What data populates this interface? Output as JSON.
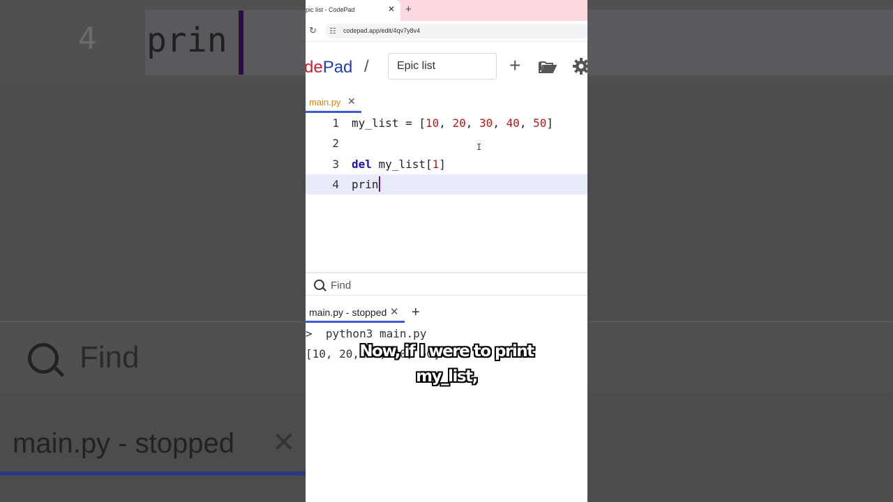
{
  "background": {
    "line_number": "4",
    "code": "prin",
    "find_label": "Find",
    "tab_label": "main.py - stopped",
    "tab_close": "✕"
  },
  "browser": {
    "tab_title": "pic list - CodePad",
    "tab_close": "✕",
    "new_tab": "+",
    "url": "codepad.app/edit/4qv7y8v4"
  },
  "app": {
    "logo_red": "de",
    "logo_blue": "Pad",
    "separator": "/",
    "project_name": "Epic list",
    "add_label": "+"
  },
  "editor": {
    "file_tab": "main.py",
    "file_tab_close": "✕",
    "lines": [
      {
        "num": "1"
      },
      {
        "num": "2"
      },
      {
        "num": "3"
      },
      {
        "num": "4"
      }
    ],
    "line1": {
      "var": "my_list",
      "op": " = ",
      "open": "[",
      "n1": "10",
      "n2": "20",
      "n3": "30",
      "n4": "40",
      "n5": "50",
      "sep": ", ",
      "close": "]"
    },
    "line3": {
      "kw": "del",
      "rest": " my_list[",
      "idx": "1",
      "close": "]"
    },
    "line4": {
      "text": "prin"
    }
  },
  "find": {
    "placeholder": "Find"
  },
  "terminal": {
    "tab_label": "main.py - stopped",
    "tab_close": "✕",
    "new_tab": "+",
    "prompt": ">  python3 main.py",
    "output": "[10, 20, 30, 40, 50]"
  },
  "caption": {
    "line1": "Now, if I were to print",
    "line2": "my_list,"
  },
  "colors": {
    "logo_blue": "#1f3fae",
    "logo_red": "#cf1f2f",
    "keyword": "#1b14a8",
    "number": "#b51a1a",
    "active_tab_underline": "#3d5bd6",
    "file_tab_text": "#d6831c",
    "browser_tabbar": "#fbd7de"
  }
}
